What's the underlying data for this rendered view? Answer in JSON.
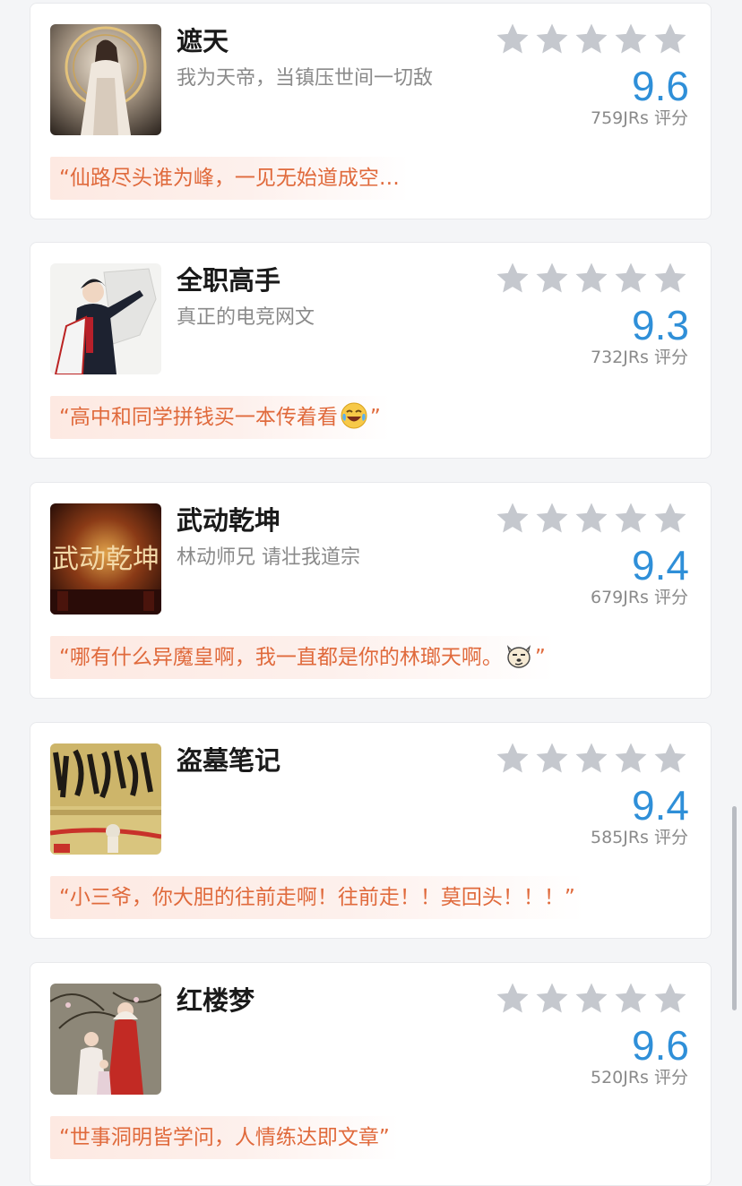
{
  "items": [
    {
      "title": "遮天",
      "subtitle": "我为天帝，当镇压世间一切敌",
      "score": "9.6",
      "rating_count": "759JRs 评分",
      "quote": "“仙路尽头谁为峰，一见无始道成空…",
      "quote_after": ""
    },
    {
      "title": "全职高手",
      "subtitle": "真正的电竞网文",
      "score": "9.3",
      "rating_count": "732JRs 评分",
      "quote": "“高中和同学拼钱买一本传着看",
      "quote_after": "”",
      "emoji": "laughing-crying-emoji-icon"
    },
    {
      "title": "武动乾坤",
      "subtitle": "林动师兄 请壮我道宗",
      "score": "9.4",
      "rating_count": "679JRs 评分",
      "quote": "“哪有什么异魔皇啊，我一直都是你的林瑯天啊。",
      "quote_after": "”",
      "emoji": "smug-dog-emoji-icon",
      "cover_text": "武动乾坤"
    },
    {
      "title": "盗墓笔记",
      "subtitle": "",
      "score": "9.4",
      "rating_count": "585JRs 评分",
      "quote": "“小三爷，你大胆的往前走啊！往前走！！莫回头！！！”",
      "quote_after": ""
    },
    {
      "title": "红楼梦",
      "subtitle": "",
      "score": "9.6",
      "rating_count": "520JRs 评分",
      "quote": "“世事洞明皆学问，人情练达即文章”",
      "quote_after": ""
    }
  ],
  "colors": {
    "accent_score": "#2f8fd8",
    "quote_text": "#e06a3c",
    "quote_bg": "#fde9e2",
    "star": "#c5c8ce"
  },
  "icons": {
    "star": "star-icon"
  }
}
